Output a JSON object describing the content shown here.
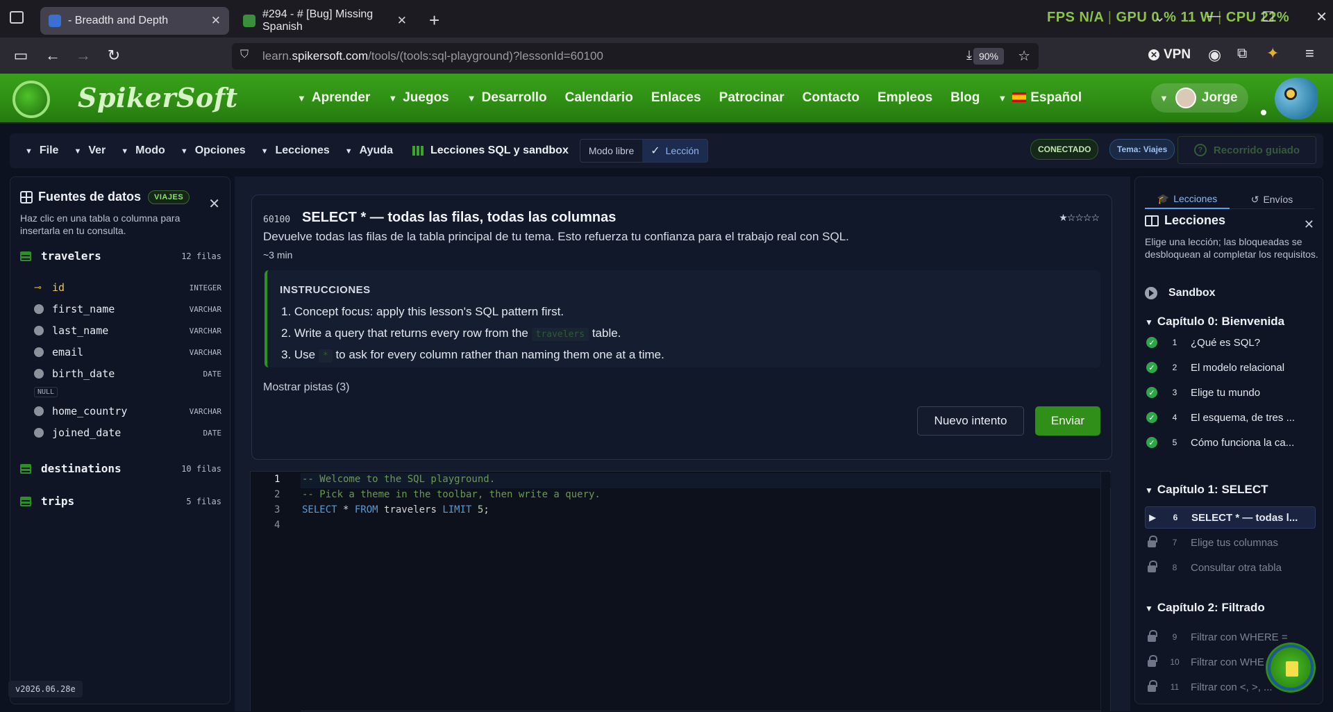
{
  "browser": {
    "tabs": [
      {
        "title": "- Breadth and Depth",
        "active": true
      },
      {
        "title": "#294 - # [Bug] Missing Spanish",
        "active": false
      }
    ],
    "hud": {
      "fps_label": "FPS",
      "fps_value": "N/A",
      "gpu_label": "GPU",
      "gpu_value": "0 %",
      "gpu_power": "11 W",
      "cpu_label": "CPU",
      "cpu_value": "22%"
    },
    "url_prefix": "learn.",
    "url_domain": "spikersoft.com",
    "url_path": "/tools/(tools:sql-playground)?lessonId=60100",
    "zoom": "90%",
    "vpn_label": "VPN"
  },
  "site": {
    "brand": "SpikerSoft",
    "nav": [
      "Aprender",
      "Juegos",
      "Desarrollo",
      "Calendario",
      "Enlaces",
      "Patrocinar",
      "Contacto",
      "Empleos",
      "Blog"
    ],
    "language": "Español",
    "user": "Jorge"
  },
  "toolbar": {
    "menus": [
      "File",
      "Ver",
      "Modo",
      "Opciones",
      "Lecciones",
      "Ayuda"
    ],
    "lesson_title": "Lecciones SQL y sandbox",
    "mode_free": "Modo libre",
    "mode_lesson": "Lección",
    "status": "CONECTADO",
    "theme": "Tema: Viajes",
    "guided": "Recorrido guiado"
  },
  "datasources": {
    "title": "Fuentes de datos",
    "badge": "VIAJES",
    "description": "Haz clic en una tabla o columna para insertarla en tu consulta.",
    "tables": [
      {
        "name": "travelers",
        "count": "12 filas"
      },
      {
        "name": "destinations",
        "count": "10 filas"
      },
      {
        "name": "trips",
        "count": "5 filas"
      }
    ],
    "columns": [
      {
        "name": "id",
        "type": "INTEGER"
      },
      {
        "name": "first_name",
        "type": "VARCHAR"
      },
      {
        "name": "last_name",
        "type": "VARCHAR"
      },
      {
        "name": "email",
        "type": "VARCHAR"
      },
      {
        "name": "birth_date",
        "type": "DATE"
      },
      {
        "name": "home_country",
        "type": "VARCHAR"
      },
      {
        "name": "joined_date",
        "type": "DATE"
      }
    ],
    "null_tag": "NULL",
    "version": "v2026.06.28e"
  },
  "lesson": {
    "number": "60100",
    "title": "SELECT * — todas las filas, todas las columnas",
    "description": "Devuelve todas las filas de la tabla principal de tu tema. Esto refuerza tu confianza para el trabajo real con SQL.",
    "time": "~3 min",
    "stars": "★☆☆☆☆",
    "instructions_title": "INSTRUCCIONES",
    "steps": [
      "1. Concept focus: apply this lesson's SQL pattern first.",
      "2. Write a query that returns every row from the",
      "table.",
      "3. Use",
      "to ask for every column rather than naming them one at a time."
    ],
    "inline_table": "travelers",
    "inline_star": "*",
    "hints": "Mostrar pistas (3)",
    "retry": "Nuevo intento",
    "submit": "Enviar"
  },
  "editor": {
    "line_numbers": [
      "1",
      "2",
      "3",
      "4"
    ],
    "line1": "-- Welcome to the SQL playground.",
    "line2": "-- Pick a theme in the toolbar, then write a query.",
    "line3_kw1": "SELECT",
    "line3_star": " * ",
    "line3_kw2": "FROM",
    "line3_id": " travelers ",
    "line3_kw3": "LIMIT",
    "line3_num": " 5",
    "line3_end": ";"
  },
  "lessons_panel": {
    "tab_lessons": "Lecciones",
    "tab_submissions": "Envíos",
    "title": "Lecciones",
    "description": "Elige una lección; las bloqueadas se desbloquean al completar los requisitos.",
    "sandbox": "Sandbox",
    "chapters": [
      {
        "title": "Capítulo 0: Bienvenida",
        "items": [
          {
            "n": "1",
            "t": "¿Qué es SQL?",
            "state": "done"
          },
          {
            "n": "2",
            "t": "El modelo relacional",
            "state": "done"
          },
          {
            "n": "3",
            "t": "Elige tu mundo",
            "state": "done"
          },
          {
            "n": "4",
            "t": "El esquema, de tres ...",
            "state": "done"
          },
          {
            "n": "5",
            "t": "Cómo funciona la ca...",
            "state": "done"
          }
        ]
      },
      {
        "title": "Capítulo 1: SELECT",
        "items": [
          {
            "n": "6",
            "t": "SELECT * — todas l...",
            "state": "current"
          },
          {
            "n": "7",
            "t": "Elige tus columnas",
            "state": "locked"
          },
          {
            "n": "8",
            "t": "Consultar otra tabla",
            "state": "locked"
          }
        ]
      },
      {
        "title": "Capítulo 2: Filtrado",
        "items": [
          {
            "n": "9",
            "t": "Filtrar con WHERE =",
            "state": "locked"
          },
          {
            "n": "10",
            "t": "Filtrar con WHE",
            "state": "locked"
          },
          {
            "n": "11",
            "t": "Filtrar con <, >, ...",
            "state": "locked"
          }
        ]
      }
    ]
  }
}
